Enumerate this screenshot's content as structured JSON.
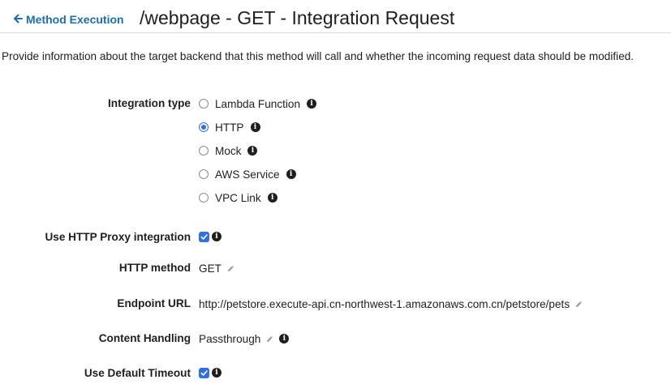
{
  "header": {
    "back_link": "Method Execution",
    "title": "/webpage - GET - Integration Request"
  },
  "description": "Provide information about the target backend that this method will call and whether the incoming request data should be modified.",
  "integration_type": {
    "label": "Integration type",
    "selected": "HTTP",
    "options": [
      {
        "label": "Lambda Function",
        "checked": false
      },
      {
        "label": "HTTP",
        "checked": true
      },
      {
        "label": "Mock",
        "checked": false
      },
      {
        "label": "AWS Service",
        "checked": false
      },
      {
        "label": "VPC Link",
        "checked": false
      }
    ]
  },
  "http_proxy": {
    "label": "Use HTTP Proxy integration",
    "checked": true
  },
  "http_method": {
    "label": "HTTP method",
    "value": "GET"
  },
  "endpoint_url": {
    "label": "Endpoint URL",
    "value": "http://petstore.execute-api.cn-northwest-1.amazonaws.com.cn/petstore/pets"
  },
  "content_handling": {
    "label": "Content Handling",
    "value": "Passthrough"
  },
  "default_timeout": {
    "label": "Use Default Timeout",
    "checked": true
  },
  "colors": {
    "link": "#1a6fb5",
    "accent": "#2f6fde",
    "text": "#1f1f1f"
  },
  "icons": {
    "back": "arrow-left-icon",
    "info": "info-circle-icon",
    "edit": "pencil-icon",
    "check": "checkmark-icon"
  }
}
